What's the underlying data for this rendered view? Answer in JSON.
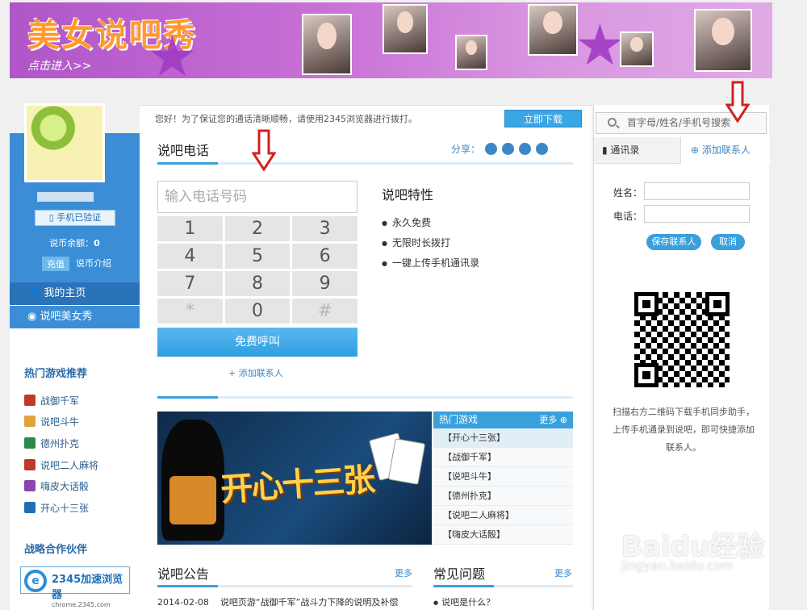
{
  "banner": {
    "title": "美女说吧秀",
    "subtitle": "点击进入>>"
  },
  "user": {
    "verified_label": "手机已验证",
    "balance_label": "说币余额：",
    "balance_value": "0",
    "recharge_label": "充值",
    "currency_intro_label": "说币介绍"
  },
  "sidebar": {
    "nav": [
      {
        "label": "我的主页"
      },
      {
        "label": "说吧美女秀"
      }
    ],
    "hot_games_title": "热门游戏推荐",
    "hot_games": [
      {
        "label": "战御千军",
        "color": "#c0392b"
      },
      {
        "label": "说吧斗牛",
        "color": "#e2a13c"
      },
      {
        "label": "德州扑克",
        "color": "#2a8a4a"
      },
      {
        "label": "说吧二人麻将",
        "color": "#c0392b"
      },
      {
        "label": "嗨皮大话骰",
        "color": "#8e44ad"
      },
      {
        "label": "开心十三张",
        "color": "#1f6fb5"
      }
    ],
    "partners_title": "战略合作伙伴",
    "partner_logo_text": "2345加速浏览器",
    "partner_logo_url_text": "chrome.2345.com"
  },
  "main": {
    "notice": "您好！为了保证您的通话清晰顺畅，请使用2345浏览器进行拨打。",
    "download_button": "立即下载",
    "section_title": "说吧电话",
    "share_label": "分享：",
    "phone_placeholder": "输入电话号码",
    "keys": [
      "1",
      "2",
      "3",
      "4",
      "5",
      "6",
      "7",
      "8",
      "9",
      "*",
      "0",
      "#"
    ],
    "call_button": "免费呼叫",
    "add_contact_link": "+ 添加联系人",
    "features_title": "说吧特性",
    "features": [
      "永久免费",
      "无限时长拨打",
      "一键上传手机通讯录"
    ],
    "promo_text": "开心十三张",
    "hot_games_header": "热门游戏",
    "more_label": "更多",
    "hot_games_list": [
      "【开心十三张】",
      "【战御千军】",
      "【说吧斗牛】",
      "【德州扑克】",
      "【说吧二人麻将】",
      "【嗨皮大话骰】"
    ],
    "announce_title": "说吧公告",
    "announce_more": "更多",
    "announce_date": "2014-02-08",
    "announce_text": "说吧页游“战御千军”战斗力下降的说明及补偿",
    "faq_title": "常见问题",
    "faq_more": "更多",
    "faq_item": "说吧是什么？"
  },
  "right": {
    "search_placeholder": "首字母/姓名/手机号搜索",
    "tab_contacts": "通讯录",
    "tab_add": "添加联系人",
    "name_label": "姓名：",
    "phone_label": "电话：",
    "save_button": "保存联系人",
    "cancel_button": "取消",
    "qr_text": "扫描右方二维码下载手机同步助手，上传手机通录到说吧，即可快捷添加联系人。"
  },
  "watermark": {
    "brand": "Baidu经验",
    "url": "jingyan.baidu.com"
  },
  "colors": {
    "accent": "#3aa0dc",
    "sidebar_blue": "#3b8ed6",
    "arrow_red": "#d42020"
  }
}
